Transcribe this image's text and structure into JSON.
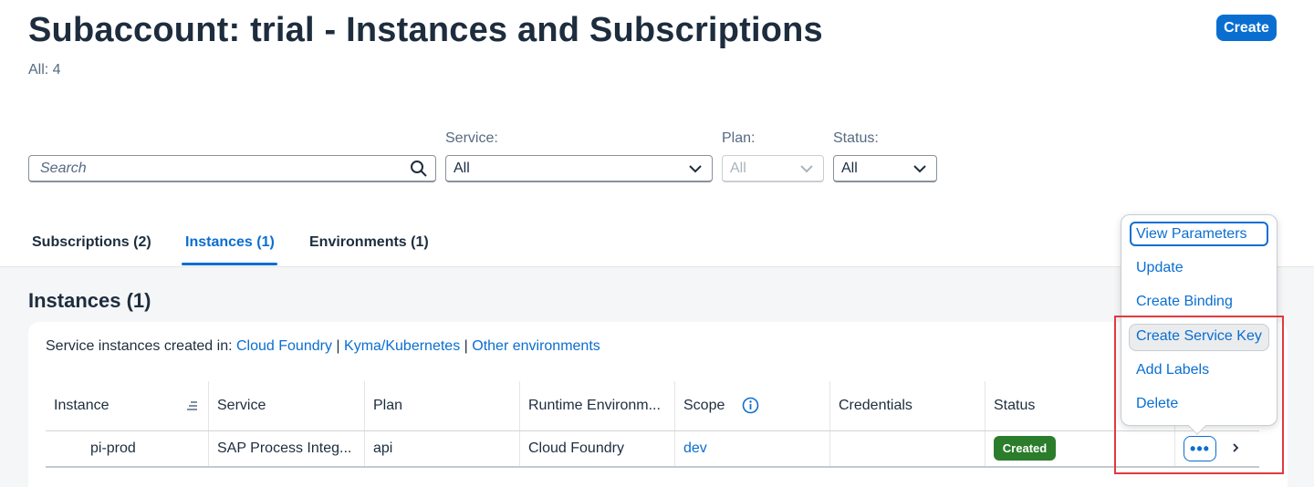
{
  "header": {
    "title": "Subaccount: trial - Instances and Subscriptions",
    "count": "All: 4",
    "create_label": "Create"
  },
  "filters": {
    "search_placeholder": "Search",
    "service_label": "Service:",
    "service_value": "All",
    "plan_label": "Plan:",
    "plan_value": "All",
    "status_label": "Status:",
    "status_value": "All"
  },
  "tabs": [
    {
      "label": "Subscriptions (2)",
      "active": false
    },
    {
      "label": "Instances (1)",
      "active": true
    },
    {
      "label": "Environments (1)",
      "active": false
    }
  ],
  "section": {
    "title": "Instances (1)",
    "info_prefix": "Service instances created in:",
    "links": [
      "Cloud Foundry",
      "Kyma/Kubernetes",
      "Other environments"
    ],
    "separator": "|"
  },
  "table": {
    "columns": [
      "Instance",
      "Service",
      "Plan",
      "Runtime Environm...",
      "Scope",
      "Credentials",
      "Status"
    ],
    "rows": [
      {
        "instance": "pi-prod",
        "service": "SAP Process Integ...",
        "plan": "api",
        "runtime": "Cloud Foundry",
        "scope": "dev",
        "credentials": "",
        "status": "Created"
      }
    ],
    "more_label": "•••"
  },
  "context_menu": {
    "items": [
      "View Parameters",
      "Update",
      "Create Binding",
      "Create Service Key",
      "Add Labels",
      "Delete"
    ]
  },
  "colors": {
    "accent": "#0a6ed1",
    "status_created": "#2b7d2b",
    "annotation_red": "#e03a3e"
  }
}
